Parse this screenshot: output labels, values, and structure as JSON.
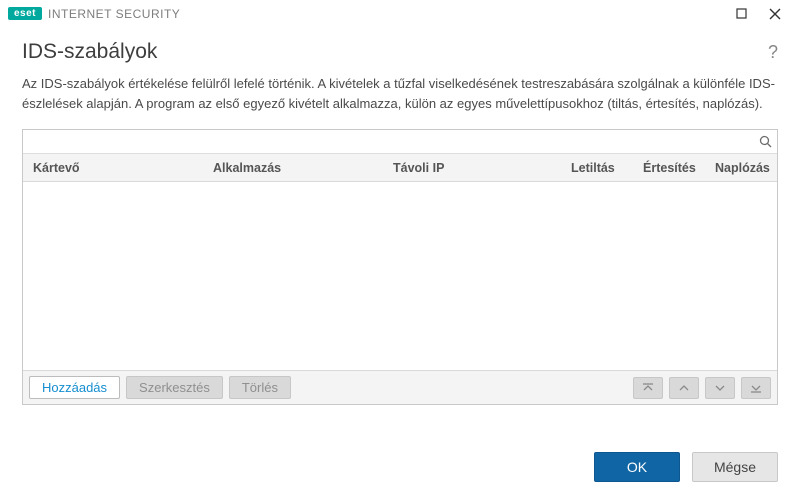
{
  "titlebar": {
    "brand_badge": "eset",
    "brand_text": "INTERNET SECURITY"
  },
  "page": {
    "title": "IDS-szabályok",
    "description": "Az IDS-szabályok értékelése felülről lefelé történik. A kivételek a tűzfal viselkedésének testreszabására szolgálnak a különféle IDS-észlelések alapján. A program az első egyező kivételt alkalmazza, külön az egyes művelettípusokhoz (tiltás, értesítés, naplózás)."
  },
  "search": {
    "value": "",
    "placeholder": ""
  },
  "table": {
    "columns": {
      "malware": "Kártevő",
      "application": "Alkalmazás",
      "remote_ip": "Távoli IP",
      "block": "Letiltás",
      "notify": "Értesítés",
      "log": "Naplózás"
    },
    "rows": []
  },
  "toolbar": {
    "add": "Hozzáadás",
    "edit": "Szerkesztés",
    "delete": "Törlés"
  },
  "footer": {
    "ok": "OK",
    "cancel": "Mégse"
  }
}
